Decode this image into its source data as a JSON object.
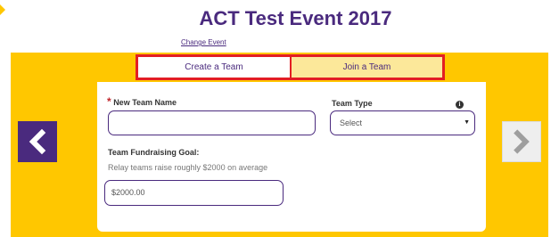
{
  "header": {
    "title": "ACT Test Event 2017",
    "change_event": "Change Event"
  },
  "tabs": [
    {
      "label": "Create a Team"
    },
    {
      "label": "Join a Team"
    }
  ],
  "form": {
    "team_name_required_mark": "*",
    "team_name_label": "New Team Name",
    "team_name_value": "",
    "team_type_label": "Team Type",
    "team_type_selected": "Select",
    "goal_label": "Team Fundraising Goal:",
    "goal_helper": "Relay teams raise roughly $2000 on average",
    "goal_value": "$2000.00"
  },
  "icons": {
    "info": "info-icon",
    "prev": "chevron-left-icon",
    "next": "chevron-right-icon"
  },
  "colors": {
    "brand_purple": "#4A2A7E",
    "band_yellow": "#FFC700",
    "highlight_red": "#E31E24",
    "join_tab_bg": "#FCE89A"
  }
}
